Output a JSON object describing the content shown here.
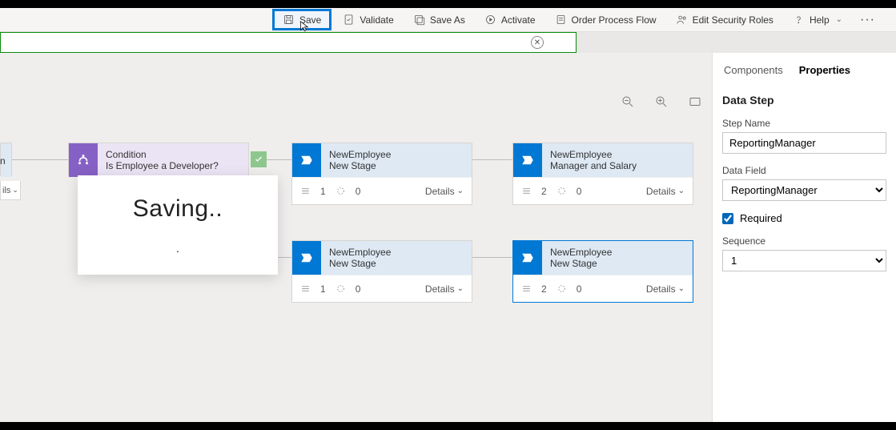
{
  "toolbar": {
    "save": "Save",
    "validate": "Validate",
    "save_as": "Save As",
    "activate": "Activate",
    "order": "Order Process Flow",
    "security": "Edit Security Roles",
    "help": "Help"
  },
  "canvas": {
    "left_slice_subtitle": "n",
    "left_details_label": "ils",
    "condition": {
      "title": "Condition",
      "subtitle": "Is Employee a Developer?"
    },
    "stage_a": {
      "entity": "NewEmployee",
      "name": "New Stage",
      "steps": "1",
      "triggers": "0",
      "details": "Details"
    },
    "stage_b": {
      "entity": "NewEmployee",
      "name": "Manager and Salary",
      "steps": "2",
      "triggers": "0",
      "details": "Details"
    },
    "stage_c": {
      "entity": "NewEmployee",
      "name": "New Stage",
      "steps": "1",
      "triggers": "0",
      "details": "Details"
    },
    "stage_d": {
      "entity": "NewEmployee",
      "name": "New Stage",
      "steps": "2",
      "triggers": "0",
      "details": "Details"
    }
  },
  "panel": {
    "tab_components": "Components",
    "tab_properties": "Properties",
    "heading": "Data Step",
    "step_name_label": "Step Name",
    "step_name_value": "ReportingManager",
    "data_field_label": "Data Field",
    "data_field_value": "ReportingManager",
    "required_label": "Required",
    "sequence_label": "Sequence",
    "sequence_value": "1"
  },
  "modal": {
    "text": "Saving..",
    "dot": "."
  }
}
